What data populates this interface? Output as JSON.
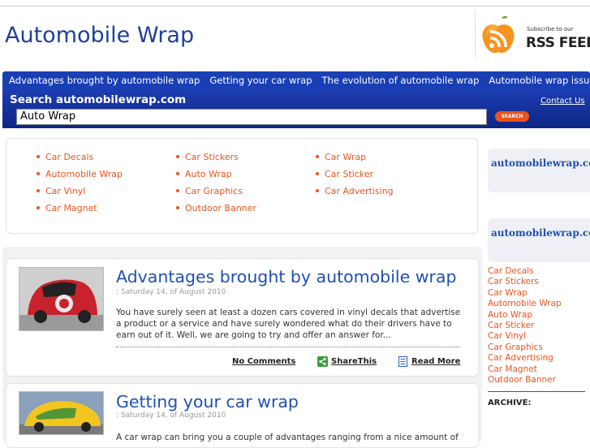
{
  "header": {
    "site_title": "Automobile Wrap",
    "rss_small": "Subscribe to our",
    "rss_big": "RSS FEED"
  },
  "nav": {
    "items": [
      "Advantages brought by automobile wrap",
      "Getting your car wrap",
      "The evolution of automobile wrap",
      "Automobile wrap issues"
    ]
  },
  "search": {
    "label": "Search automobilewrap.com",
    "value": "Auto Wrap",
    "button": "SEARCH",
    "contact": "Contact Us"
  },
  "links": {
    "col1": [
      "Car Decals",
      "Automobile Wrap",
      "Car Vinyl",
      "Car Magnet"
    ],
    "col2": [
      "Car Stickers",
      "Auto Wrap",
      "Car Graphics",
      "Outdoor Banner"
    ],
    "col3": [
      "Car Wrap",
      "Car Sticker",
      "Car Advertising"
    ]
  },
  "posts": [
    {
      "title": "Advantages brought by automobile wrap",
      "date": ": Saturday 14, of August 2010",
      "excerpt": "You have surely seen at least a dozen cars covered in vinyl decals that advertise a product or a service and have surely wondered what do their drivers have to earn out of it. Well, we are going to try and offer an answer for...",
      "comments": "No Comments",
      "share": "ShareThis",
      "more": "Read More"
    },
    {
      "title": "Getting your car wrap",
      "date": ": Saturday 14, of August 2010",
      "excerpt": "A car wrap can bring you a couple of advantages ranging from a nice amount of"
    }
  ],
  "sidebar": {
    "links_title": "automobilewrap.com Links",
    "categories_title": "automobilewrap.com Categories",
    "categories": [
      "Car Decals",
      "Car Stickers",
      "Car Wrap",
      "Automobile Wrap",
      "Auto Wrap",
      "Car Sticker",
      "Car Vinyl",
      "Car Graphics",
      "Car Advertising",
      "Car Magnet",
      "Outdoor Banner"
    ],
    "archive": "ARCHIVE:"
  },
  "colors": {
    "brand_blue": "#1a3fb5",
    "link_orange": "#e8541f",
    "title_blue": "#1f50b0"
  }
}
